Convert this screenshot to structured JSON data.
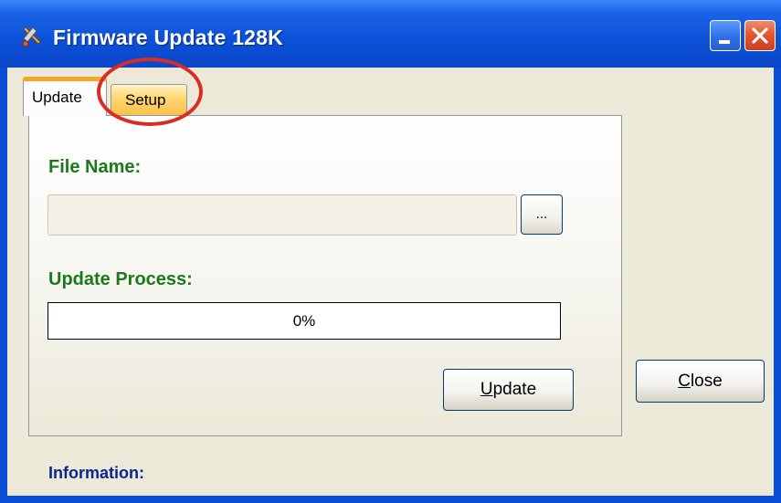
{
  "window": {
    "title": "Firmware Update 128K"
  },
  "tabs": {
    "update": "Update",
    "setup": "Setup"
  },
  "form": {
    "file_name_label": "File Name:",
    "file_name_value": "",
    "browse_label": "...",
    "process_label": "Update Process:",
    "progress_text": "0%",
    "progress_fraction": 0
  },
  "buttons": {
    "update": {
      "mnemonic": "U",
      "rest": "pdate"
    },
    "close": {
      "mnemonic": "C",
      "rest": "lose"
    }
  },
  "footer": {
    "info_label": "Information:"
  },
  "colors": {
    "title_bar": "#0b51d8",
    "label_green": "#1a7a1a",
    "info_blue": "#0b2490",
    "callout_red": "#dd2a22",
    "active_tab_accent": "#f5a629"
  },
  "icons": {
    "app": "wrench-keys-icon",
    "minimize": "minimize-icon",
    "close": "close-icon"
  }
}
